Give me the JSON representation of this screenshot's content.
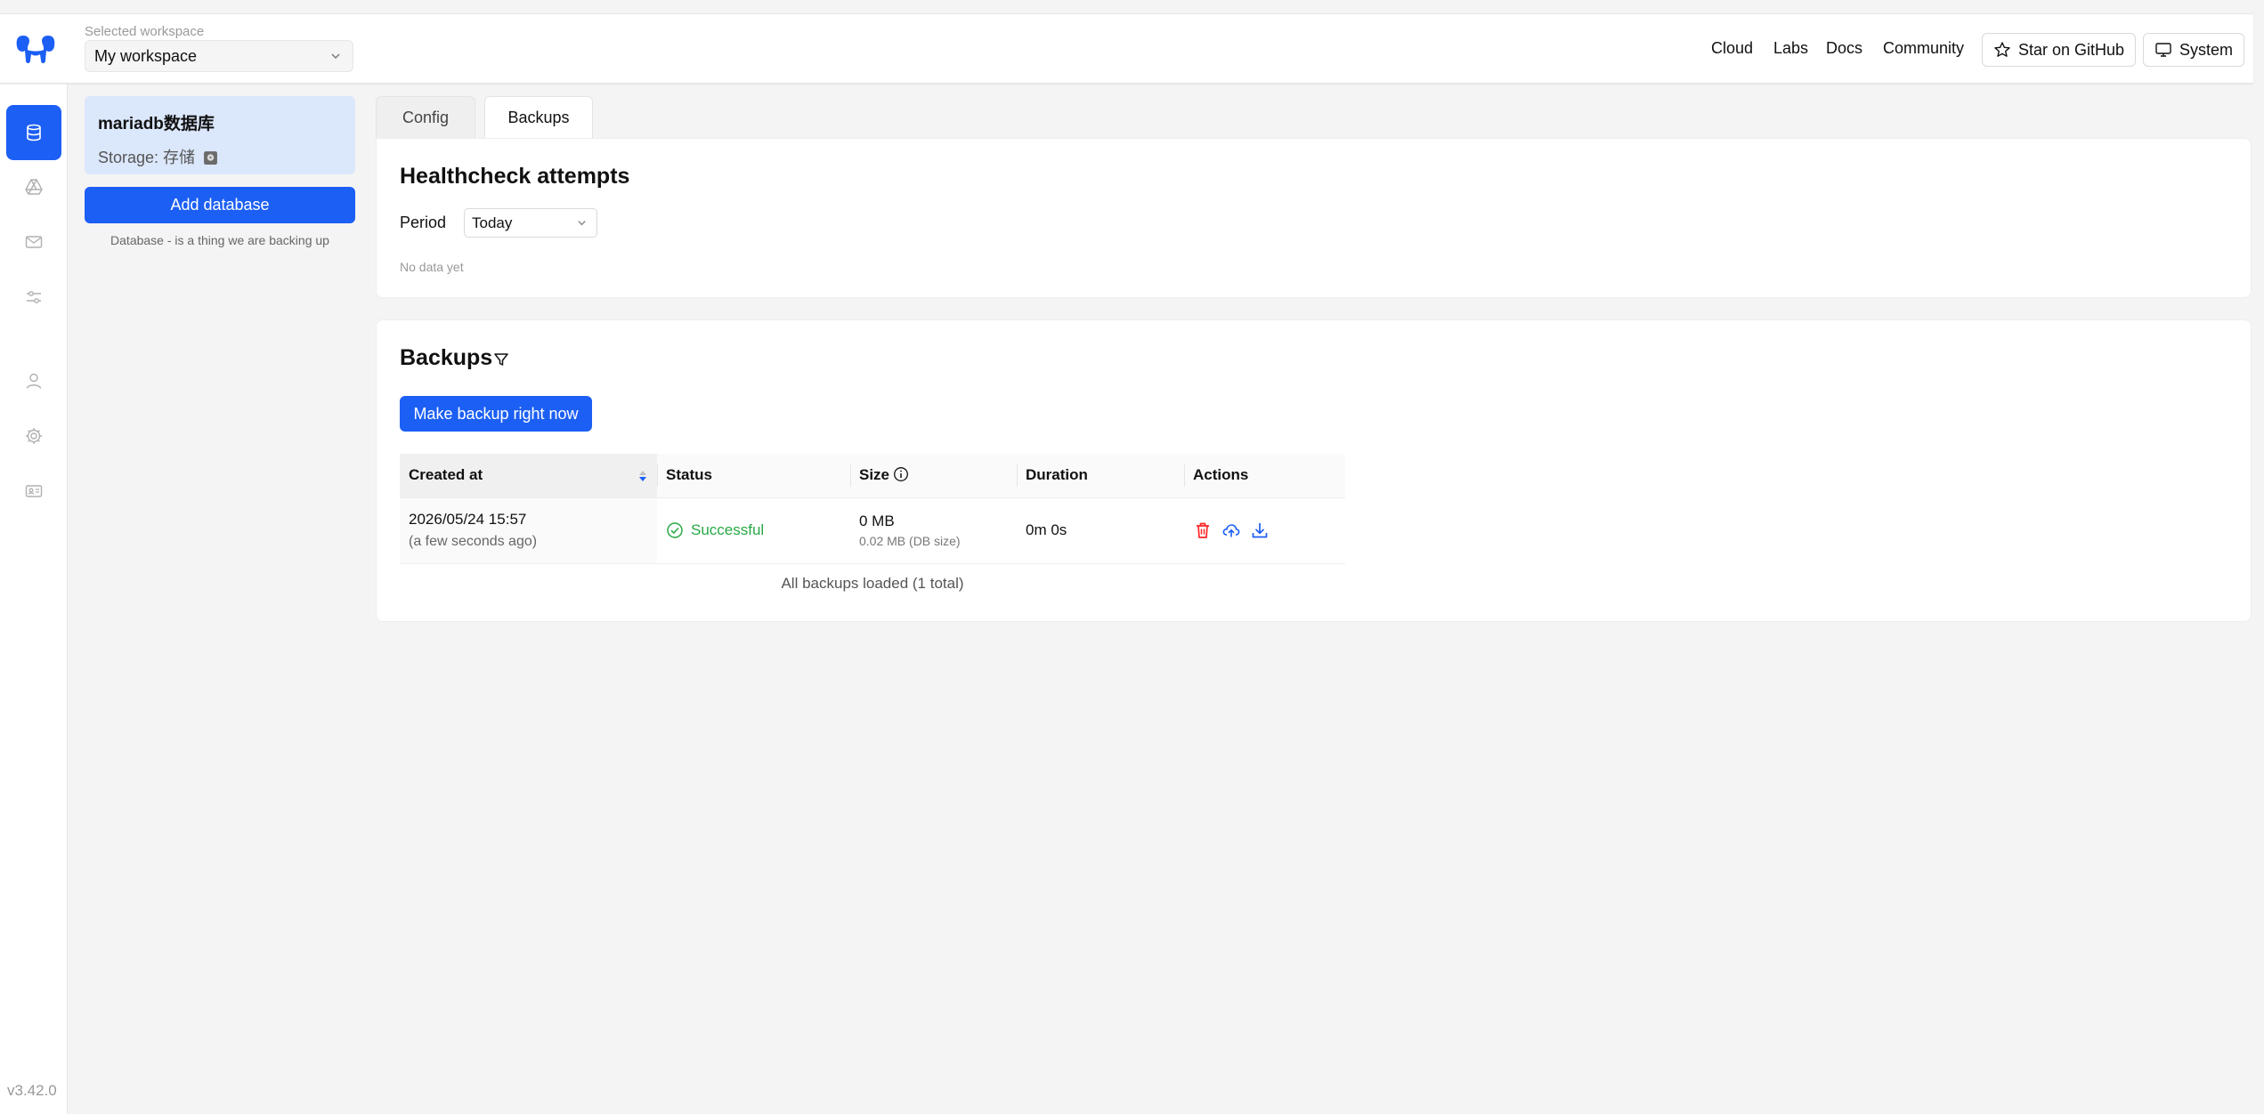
{
  "colors": {
    "accent": "#1c5ff4",
    "success": "#27a844",
    "danger": "#ff2424"
  },
  "header": {
    "workspace_label": "Selected workspace",
    "workspace_value": "My workspace",
    "nav": [
      "Cloud",
      "Labs",
      "Docs",
      "Community"
    ],
    "github_label": "Star on GitHub",
    "theme_label": "System"
  },
  "sidebar": {
    "icons": [
      "database-icon",
      "drive-icon",
      "mail-icon",
      "sliders-icon",
      "user-icon",
      "gear-icon",
      "id-card-icon"
    ],
    "version": "v3.42.0"
  },
  "databases": {
    "items": [
      {
        "name": "mariadb数据库",
        "storage": "Storage: 存储"
      }
    ],
    "add_label": "Add database",
    "hint": "Database - is a thing we are backing up"
  },
  "tabs": [
    "Config",
    "Backups"
  ],
  "healthcheck": {
    "title": "Healthcheck attempts",
    "period_label": "Period",
    "period_value": "Today",
    "empty_text": "No data yet"
  },
  "backups": {
    "title": "Backups",
    "make_label": "Make backup right now",
    "columns": [
      "Created at",
      "Status",
      "Size",
      "Duration",
      "Actions"
    ],
    "rows": [
      {
        "created": "2026/05/24 15:57",
        "created_rel": "(a few seconds ago)",
        "status": "Successful",
        "size": "0 MB",
        "db_size": "0.02 MB (DB size)",
        "duration": "0m 0s"
      }
    ],
    "footer": "All backups loaded (1 total)"
  }
}
